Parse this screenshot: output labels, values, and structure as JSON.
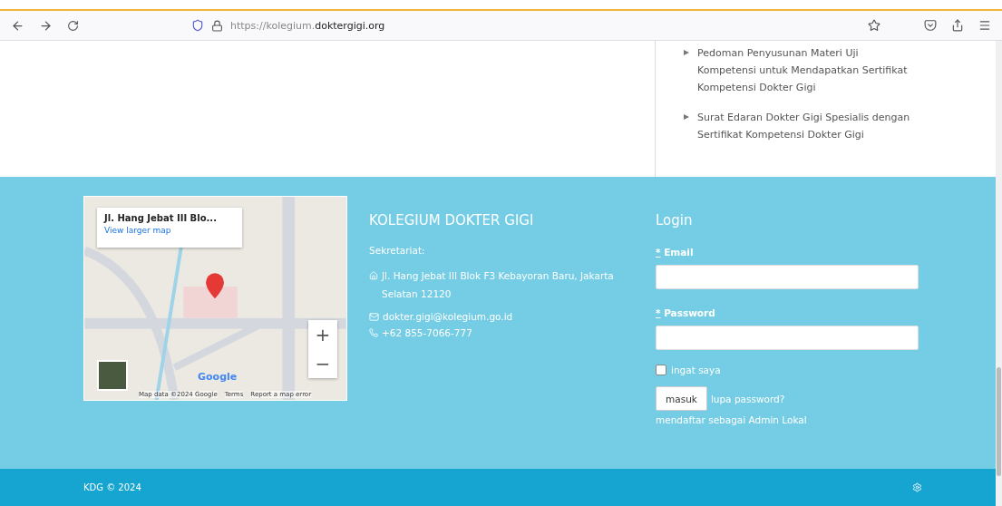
{
  "browser": {
    "url_prefix": "https://kolegium.",
    "url_domain": "doktergigi.org"
  },
  "links": [
    {
      "text": "Pedoman Penyusunan Materi Uji Kompetensi untuk Mendapatkan Sertifikat Kompetensi Dokter Gigi"
    },
    {
      "text": "Surat Edaran Dokter Gigi Spesialis dengan Sertifikat Kompetensi Dokter Gigi"
    }
  ],
  "map": {
    "place_title": "Jl. Hang Jebat III Blo...",
    "link": "View larger map",
    "zoom_in": "+",
    "zoom_out": "−",
    "logo": "Google",
    "attribution": "Map data ©2024 Google",
    "terms": "Terms",
    "report": "Report a map error"
  },
  "contact": {
    "title": "KOLEGIUM DOKTER GIGI",
    "label": "Sekretariat:",
    "address": "Jl. Hang Jebat III Blok F3 Kebayoran Baru, Jakarta Selatan 12120",
    "email": "dokter.gigi@kolegium.go.id",
    "phone": "+62 855-7066-777"
  },
  "login": {
    "title": "Login",
    "fields": [
      {
        "mark": "*",
        "label": "Email"
      },
      {
        "mark": "*",
        "label": "Password"
      }
    ],
    "remember": {
      "label": "ingat saya",
      "checked": false
    },
    "submit": "masuk",
    "forgot": "lupa password?",
    "register": "mendaftar sebagai Admin Lokal"
  },
  "footer": {
    "copyright": "KDG © 2024"
  }
}
